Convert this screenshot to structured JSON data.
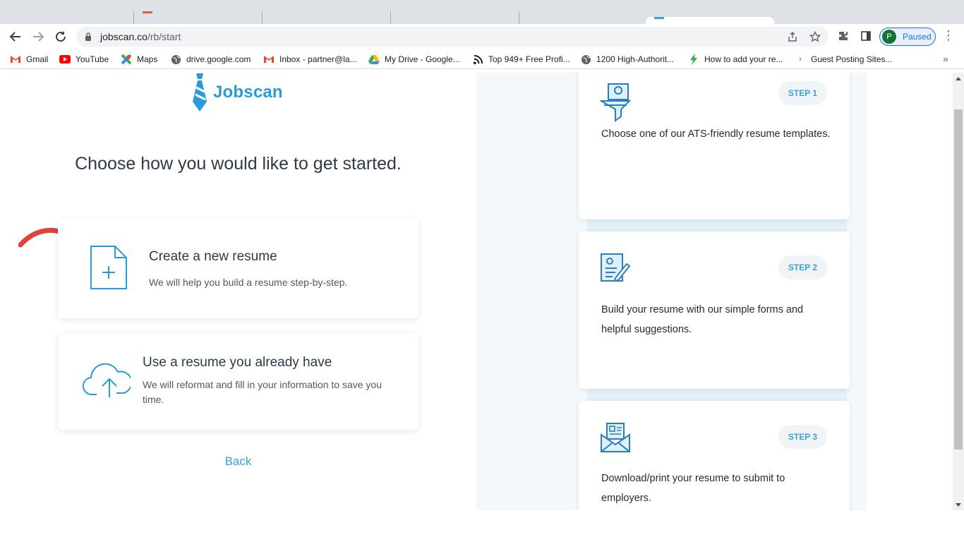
{
  "browser": {
    "url_host": "jobscan.co",
    "url_path": "/rb/start",
    "profile_initial": "P",
    "profile_status": "Paused"
  },
  "bookmarks": [
    {
      "label": "Gmail",
      "icon": "gmail-icon"
    },
    {
      "label": "YouTube",
      "icon": "youtube-icon"
    },
    {
      "label": "Maps",
      "icon": "maps-icon"
    },
    {
      "label": "drive.google.com",
      "icon": "globe-icon"
    },
    {
      "label": "Inbox - partner@la...",
      "icon": "gmail-icon"
    },
    {
      "label": "My Drive - Google...",
      "icon": "drive-icon"
    },
    {
      "label": "Top 949+ Free Profi...",
      "icon": "rss-icon"
    },
    {
      "label": "1200 High-Authorit...",
      "icon": "globe-icon"
    },
    {
      "label": "How to add your re...",
      "icon": "bolt-icon"
    },
    {
      "label": "Guest Posting Sites...",
      "icon": "chevron-icon"
    }
  ],
  "page": {
    "logo_text": "Jobscan",
    "headline": "Choose how you would like to get started.",
    "options": [
      {
        "title": "Create a new resume",
        "desc": "We will help you build a resume step-by-step."
      },
      {
        "title": "Use a resume you already have",
        "desc": "We will reformat and fill in your information to save you time."
      }
    ],
    "back_label": "Back",
    "steps": [
      {
        "badge": "STEP 1",
        "text": "Choose one of our ATS-friendly resume templates."
      },
      {
        "badge": "STEP 2",
        "text": "Build your resume with our simple forms and helpful suggestions."
      },
      {
        "badge": "STEP 3",
        "text": "Download/print your resume to submit to employers."
      }
    ]
  },
  "colors": {
    "brand": "#2b9bd8",
    "link": "#3aa3d9",
    "arrow": "#e0433a"
  }
}
